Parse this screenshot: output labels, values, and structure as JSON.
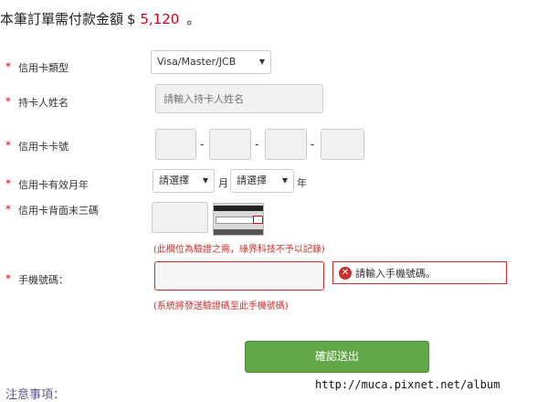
{
  "header": {
    "prefix": "本筆訂單需付款金額",
    "currency": "$",
    "amount": "5,120",
    "suffix": "。"
  },
  "form": {
    "required_mark": "*",
    "card_type": {
      "label": "信用卡類型",
      "value": "Visa/Master/JCB"
    },
    "holder": {
      "label": "持卡人姓名",
      "placeholder": "請輸入持卡人姓名"
    },
    "card_number": {
      "label": "信用卡卡號",
      "separator": "-"
    },
    "expiry": {
      "label": "信用卡有效月年",
      "month_value": "請選擇",
      "month_unit": "月",
      "year_value": "請選擇",
      "year_unit": "年"
    },
    "cvv": {
      "label": "信用卡背面末三碼",
      "note": "(此欄位為驗證之需，綠界科技不予以記錄)"
    },
    "phone": {
      "label": "手機號碼：",
      "error": "請輸入手機號碼。",
      "note": "(系統將發送驗證碼至此手機號碼)"
    },
    "submit": "確認送出"
  },
  "watermark": "http://muca.pixnet.net/album",
  "bottom_fragment": "注意事項："
}
